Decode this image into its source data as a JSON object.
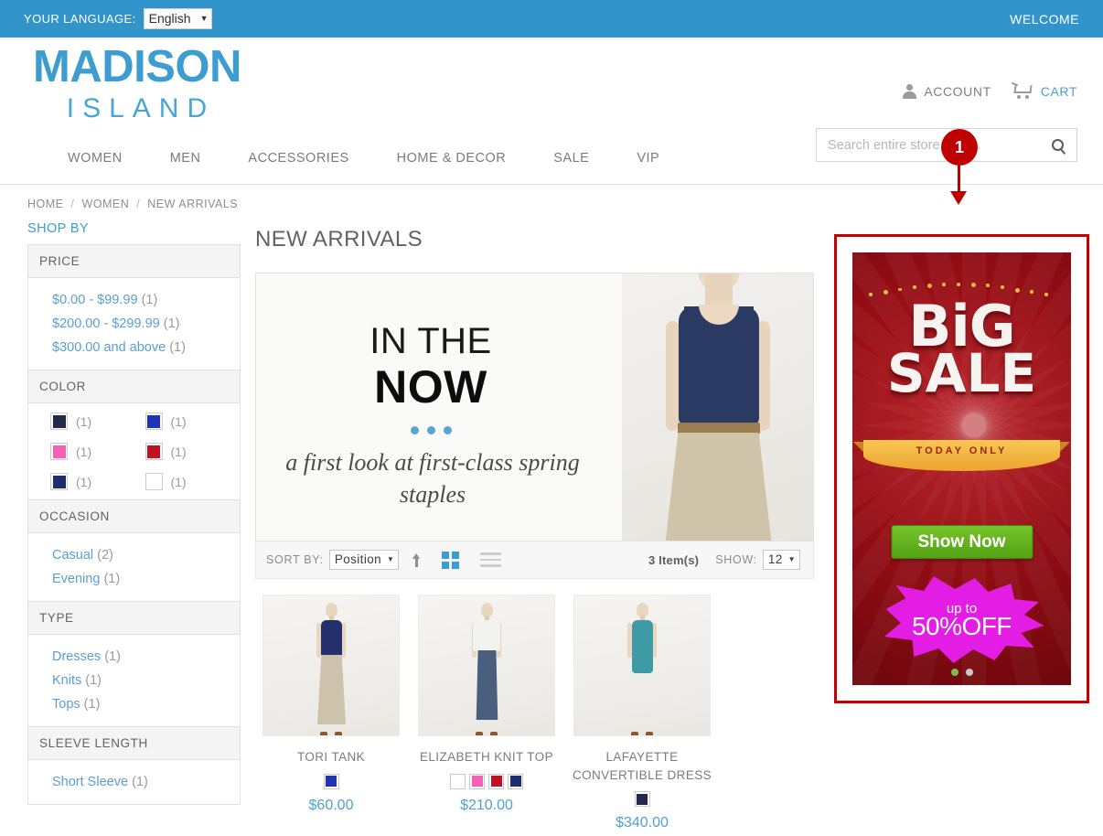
{
  "topbar": {
    "language_label": "YOUR LANGUAGE:",
    "language_value": "English",
    "welcome": "WELCOME"
  },
  "header": {
    "logo_main": "MADISON",
    "logo_sub": "ISLAND",
    "account_label": "ACCOUNT",
    "cart_label": "CART",
    "search_placeholder": "Search entire store here...",
    "search_value": ""
  },
  "nav": {
    "items": [
      {
        "label": "WOMEN"
      },
      {
        "label": "MEN"
      },
      {
        "label": "ACCESSORIES"
      },
      {
        "label": "HOME & DECOR"
      },
      {
        "label": "SALE"
      },
      {
        "label": "VIP"
      }
    ]
  },
  "breadcrumb": {
    "items": [
      {
        "label": "HOME"
      },
      {
        "label": "WOMEN"
      },
      {
        "label": "NEW ARRIVALS"
      }
    ],
    "separator": "/"
  },
  "sidebar": {
    "shop_by": "SHOP BY",
    "blocks": [
      {
        "title": "PRICE",
        "type": "links",
        "items": [
          {
            "label": "$0.00 - $99.99",
            "count": "(1)"
          },
          {
            "label": "$200.00 - $299.99",
            "count": "(1)"
          },
          {
            "label": "$300.00 and above",
            "count": "(1)"
          }
        ]
      },
      {
        "title": "COLOR",
        "type": "swatches",
        "items": [
          {
            "color": "#23294b",
            "count": "(1)"
          },
          {
            "color": "#1f33b3",
            "count": "(1)"
          },
          {
            "color": "#f55fb4",
            "count": "(1)"
          },
          {
            "color": "#be1124",
            "count": "(1)"
          },
          {
            "color": "#1b2e6e",
            "count": "(1)"
          },
          {
            "color": "#ffffff",
            "count": "(1)"
          }
        ]
      },
      {
        "title": "OCCASION",
        "type": "links",
        "items": [
          {
            "label": "Casual",
            "count": "(2)"
          },
          {
            "label": "Evening",
            "count": "(1)"
          }
        ]
      },
      {
        "title": "TYPE",
        "type": "links",
        "items": [
          {
            "label": "Dresses",
            "count": "(1)"
          },
          {
            "label": "Knits",
            "count": "(1)"
          },
          {
            "label": "Tops",
            "count": "(1)"
          }
        ]
      },
      {
        "title": "SLEEVE LENGTH",
        "type": "links",
        "items": [
          {
            "label": "Short Sleeve",
            "count": "(1)"
          }
        ]
      }
    ]
  },
  "main": {
    "page_title": "NEW ARRIVALS",
    "hero": {
      "line1": "IN THE",
      "line2": "NOW",
      "tagline": "a first look at first-class spring staples"
    },
    "toolbar": {
      "sort_by_label": "SORT BY:",
      "sort_by_value": "Position",
      "item_count": "3 Item(s)",
      "show_label": "SHOW:",
      "show_value": "12"
    },
    "products": [
      {
        "name": "TORI TANK",
        "price": "$60.00",
        "swatches": [
          "#1f33b3"
        ]
      },
      {
        "name": "ELIZABETH KNIT TOP",
        "price": "$210.00",
        "swatches": [
          "#ffffff",
          "#f55fb4",
          "#be1124",
          "#1b2e6e"
        ]
      },
      {
        "name": "LAFAYETTE CONVERTIBLE DRESS",
        "price": "$340.00",
        "swatches": [
          "#23294b"
        ]
      }
    ]
  },
  "promo_banner": {
    "title_big": "BiG",
    "title_sale": "SALE",
    "ribbon_text": "TODAY ONLY",
    "button_label": "Show Now",
    "burst_up": "up to",
    "burst_off": "50%OFF",
    "accent_green": "#5aa81a",
    "accent_magenta": "#e41de4",
    "highlight_color": "#c40000"
  },
  "annotation": {
    "marker_number": "1"
  }
}
